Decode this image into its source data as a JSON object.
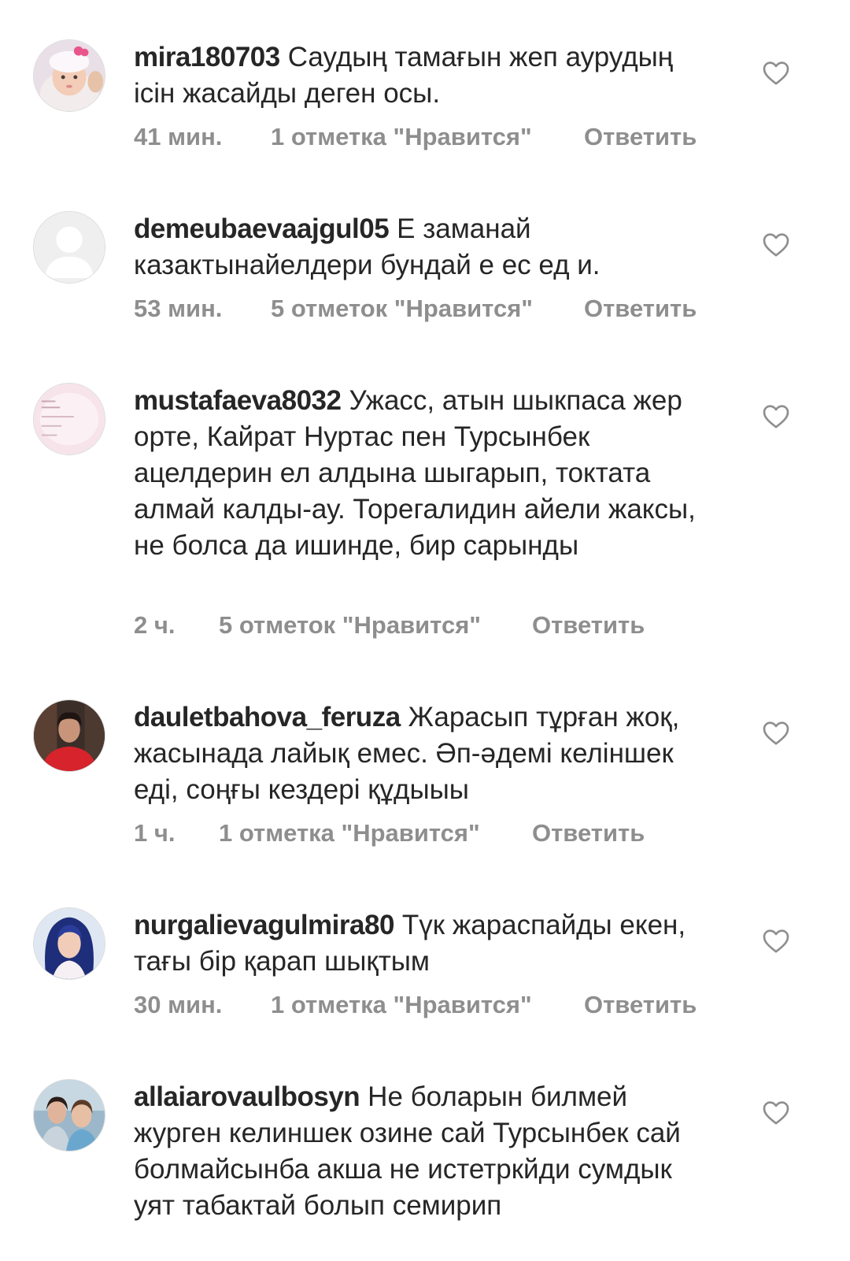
{
  "comments": [
    {
      "username": "mira180703",
      "text": "Саудың тамағын жеп аурудың ісін жасайды деген осы.",
      "time": "41 мин.",
      "likes": "1 отметка \"Нравится\"",
      "reply": "Ответить",
      "avatar": "baby-photo"
    },
    {
      "username": "demeubaevaajgul05",
      "text": "Е заманай казактынайелдери бундай е ес ед и.",
      "time": "53 мин.",
      "likes": "5 отметок \"Нравится\"",
      "reply": "Ответить",
      "avatar": "default-person"
    },
    {
      "username": "mustafaeva8032",
      "text": "Ужасс, атын шыкпаса жер орте, Кайрат Нуртас пен Турсынбек ацелдерин ел алдына шыгарып, токтата алмай калды-ау. Торегалидин айели жаксы, не болса да ишинде, бир сарынды",
      "time": "2 ч.",
      "likes": "5 отметок \"Нравится\"",
      "reply": "Ответить",
      "avatar": "pink-card"
    },
    {
      "username": "dauletbahova_feruza",
      "text": "Жарасып тұрған жоқ, жасынада лайық емес. Әп-әдемі келіншек еді, соңғы кездері құдыыы",
      "time": "1 ч.",
      "likes": "1 отметка \"Нравится\"",
      "reply": "Ответить",
      "avatar": "woman-red"
    },
    {
      "username": "nurgalievagulmira80",
      "text": "Түк жараспайды екен, тағы бір қарап шықтым",
      "time": "30 мин.",
      "likes": "1 отметка \"Нравится\"",
      "reply": "Ответить",
      "avatar": "woman-blue-hair"
    },
    {
      "username": "allaiarovaulbosyn",
      "text": "Не боларын билмей журген келиншек озине сай Турсынбек сай болмайсынба акша не истетркйди сумдык уят табактай болып семирип",
      "avatar": "two-women"
    }
  ],
  "colors": {
    "text": "#262626",
    "meta": "#8e8e8e",
    "heart": "#8e8e8e"
  },
  "icons": {
    "like": "heart-outline-icon"
  }
}
